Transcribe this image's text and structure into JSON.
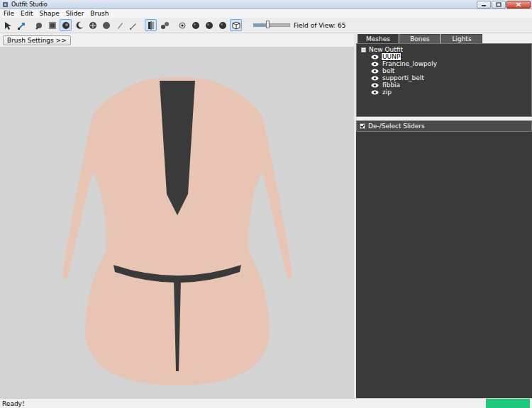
{
  "window": {
    "title": "Outfit Studio"
  },
  "menu": [
    "File",
    "Edit",
    "Shape",
    "Slider",
    "Brush"
  ],
  "toolbar": {
    "tools": [
      {
        "kind": "select",
        "selected": false
      },
      {
        "kind": "transform",
        "selected": false
      },
      {
        "kind": "brush",
        "selected": false
      },
      {
        "kind": "inflate",
        "selected": false
      },
      {
        "kind": "deflate",
        "selected": true
      },
      {
        "kind": "moon",
        "selected": false
      },
      {
        "kind": "move",
        "selected": false
      },
      {
        "kind": "smooth",
        "selected": false
      },
      {
        "kind": "weight",
        "selected": false
      },
      {
        "kind": "pen",
        "selected": false
      },
      {
        "kind": "mirror",
        "selected": true
      },
      {
        "kind": "connected",
        "selected": false
      },
      {
        "kind": "dot",
        "selected": false
      },
      {
        "kind": "sphere",
        "selected": false
      },
      {
        "kind": "sphere",
        "selected": false
      },
      {
        "kind": "sphere",
        "selected": false
      },
      {
        "kind": "cube",
        "selected": true
      }
    ],
    "field_of_view": {
      "label": "Field of View: 65",
      "level": 0.38
    }
  },
  "brush_settings": "Brush Settings >>",
  "tabs": [
    {
      "label": "Meshes",
      "selected": true
    },
    {
      "label": "Bones",
      "selected": false
    },
    {
      "label": "Lights",
      "selected": false
    }
  ],
  "tree": {
    "root": {
      "label": "New Outfit",
      "expanded": true,
      "expander": "−"
    },
    "items": [
      {
        "label": "UUNP",
        "visible": true,
        "selected": true
      },
      {
        "label": "Francine_lowpoly",
        "visible": true,
        "selected": false
      },
      {
        "label": "belt",
        "visible": true,
        "selected": false
      },
      {
        "label": "supporti_belt",
        "visible": true,
        "selected": false
      },
      {
        "label": "fibbia",
        "visible": true,
        "selected": false
      },
      {
        "label": "zip",
        "visible": true,
        "selected": false
      }
    ]
  },
  "sliders_header": {
    "label": "De-/Select Sliders",
    "checked": true
  },
  "status_bar": "Ready!"
}
